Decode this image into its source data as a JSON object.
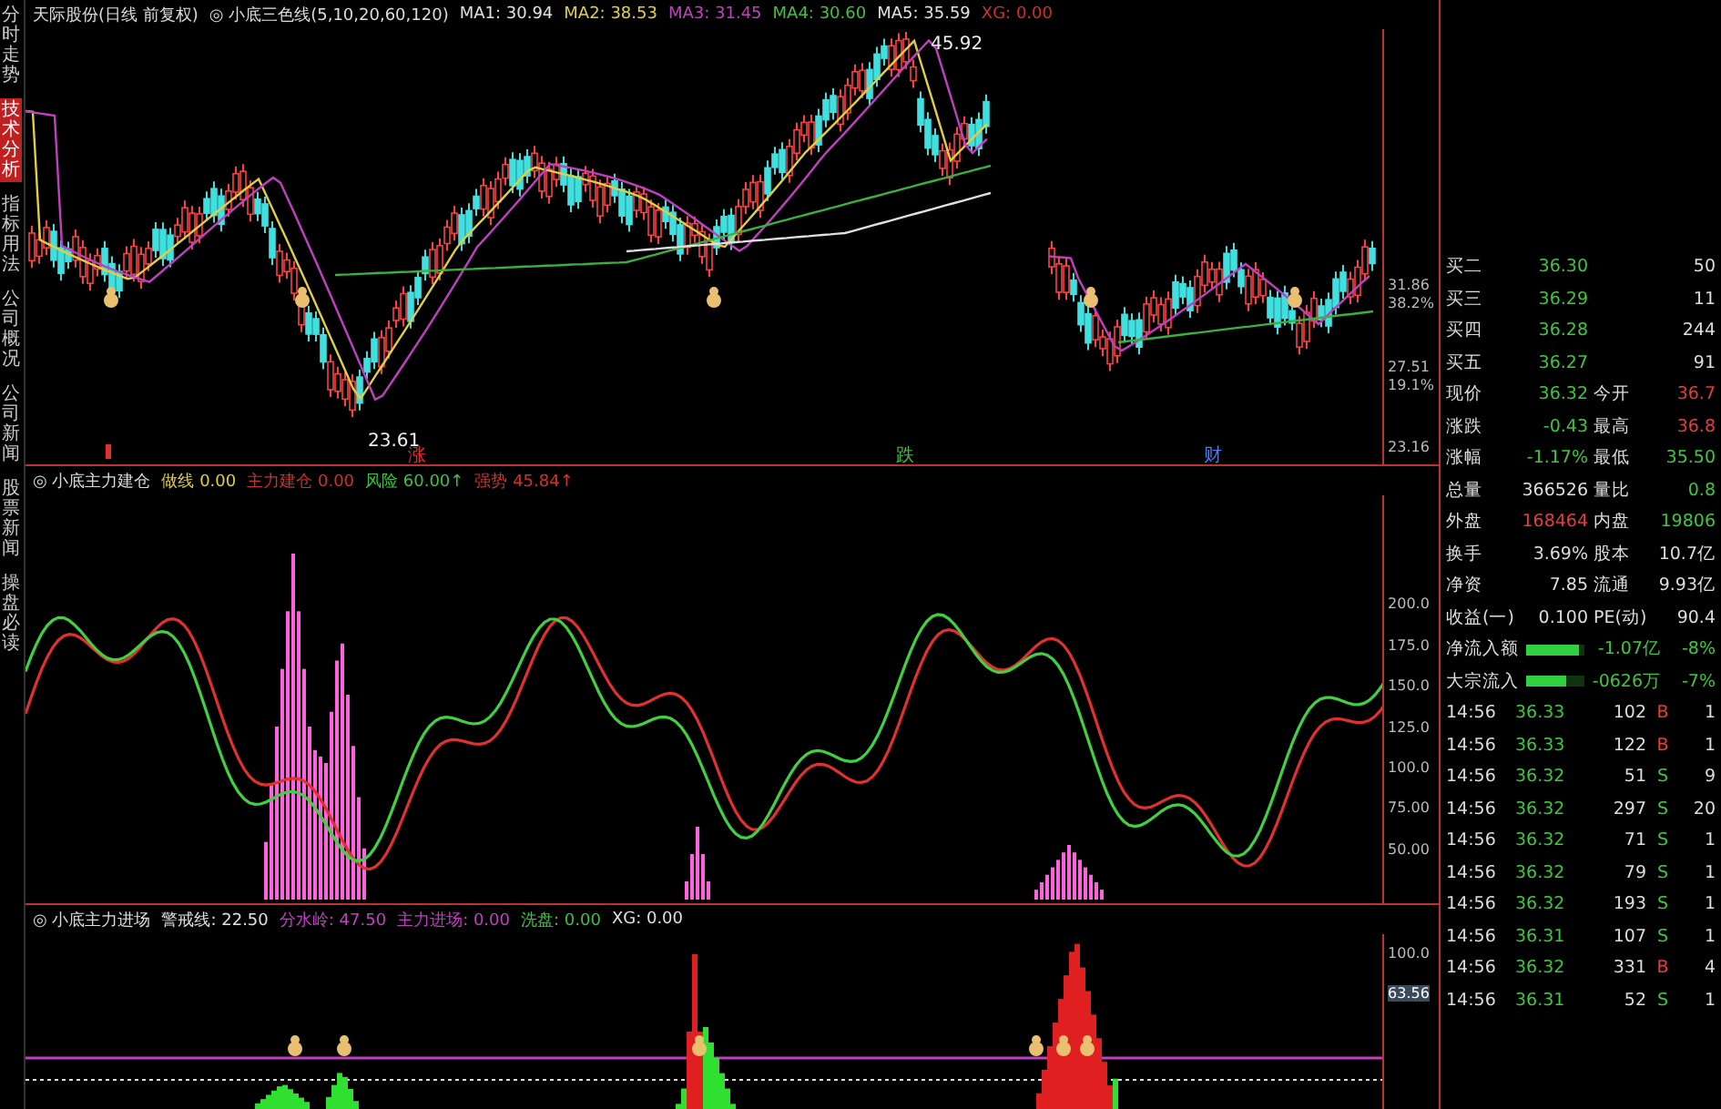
{
  "side_tabs": [
    {
      "label": "分时走势",
      "selected": false
    },
    {
      "label": "技术分析",
      "selected": true
    },
    {
      "label": "指标用法",
      "selected": false
    },
    {
      "label": "公司概况",
      "selected": false
    },
    {
      "label": "公司新闻",
      "selected": false
    },
    {
      "label": "股票新闻",
      "selected": false
    },
    {
      "label": "操盘必读",
      "selected": false
    }
  ],
  "price_panel": {
    "stock": "天际股份(日线 前复权)",
    "indicator": "◎ 小底三色线(5,10,20,60,120)",
    "values": [
      {
        "label": "MA1:",
        "value": "30.94",
        "color": "#e0e0e0"
      },
      {
        "label": "MA2:",
        "value": "38.53",
        "color": "#e0d040"
      },
      {
        "label": "MA3:",
        "value": "31.45",
        "color": "#c040c0"
      },
      {
        "label": "MA4:",
        "value": "30.60",
        "color": "#40c040"
      },
      {
        "label": "MA5:",
        "value": "35.59",
        "color": "#e0e0e0"
      },
      {
        "label": "XG:",
        "value": "0.00",
        "color": "#d03030"
      }
    ],
    "high_label": "45.92",
    "low_label": "23.61",
    "events": [
      {
        "label": "涨",
        "color": "#e03030"
      },
      {
        "label": "跌",
        "color": "#40c040"
      },
      {
        "label": "财",
        "color": "#4080ff"
      }
    ],
    "axis": [
      "31.86",
      "38.2%",
      "27.51",
      "19.1%",
      "23.16"
    ]
  },
  "build_panel": {
    "indicator": "◎ 小底主力建仓",
    "values": [
      {
        "label": "做线",
        "value": "0.00",
        "color": "#e0d040"
      },
      {
        "label": "主力建仓",
        "value": "0.00",
        "color": "#d03030"
      },
      {
        "label": "风险",
        "value": "60.00↑",
        "color": "#40c040"
      },
      {
        "label": "强势",
        "value": "45.84↑",
        "color": "#d03030"
      }
    ],
    "axis": [
      "200.0",
      "175.0",
      "150.0",
      "125.0",
      "100.0",
      "75.00",
      "50.00"
    ]
  },
  "entry_panel": {
    "indicator": "◎ 小底主力进场",
    "values": [
      {
        "label": "警戒线:",
        "value": "22.50",
        "color": "#e0e0e0"
      },
      {
        "label": "分水岭:",
        "value": "47.50",
        "color": "#c040c0"
      },
      {
        "label": "主力进场:",
        "value": "0.00",
        "color": "#c040c0"
      },
      {
        "label": "洗盘:",
        "value": "0.00",
        "color": "#40c040"
      },
      {
        "label": "XG:",
        "value": "0.00",
        "color": "#e0e0e0"
      }
    ],
    "axis": [
      "100.0",
      "63.56"
    ]
  },
  "quote_rows": [
    {
      "label": "买二",
      "value": {
        "text": "36.30",
        "color": "#3cc83c"
      },
      "value_2": {
        "text": "50",
        "color": "#dddddd"
      }
    },
    {
      "label": "买三",
      "value": {
        "text": "36.29",
        "color": "#3cc83c"
      },
      "value_2": {
        "text": "11",
        "color": "#dddddd"
      }
    },
    {
      "label": "买四",
      "value": {
        "text": "36.28",
        "color": "#3cc83c"
      },
      "value_2": {
        "text": "244",
        "color": "#dddddd"
      }
    },
    {
      "label": "买五",
      "value": {
        "text": "36.27",
        "color": "#3cc83c"
      },
      "value_2": {
        "text": "91",
        "color": "#dddddd"
      }
    },
    {
      "label": "现价",
      "value": {
        "text": "36.32",
        "color": "#3cc83c"
      },
      "label_2": "今开",
      "value_2": {
        "text": "36.7",
        "color": "#e83c3c"
      }
    },
    {
      "label": "涨跌",
      "value": {
        "text": "-0.43",
        "color": "#3cc83c"
      },
      "label_2": "最高",
      "value_2": {
        "text": "36.8",
        "color": "#e83c3c"
      }
    },
    {
      "label": "涨幅",
      "value": {
        "text": "-1.17%",
        "color": "#3cc83c"
      },
      "label_2": "最低",
      "value_2": {
        "text": "35.50",
        "color": "#3cc83c"
      }
    },
    {
      "label": "总量",
      "value": {
        "text": "366526",
        "color": "#dddddd"
      },
      "label_2": "量比",
      "value_2": {
        "text": "0.8",
        "color": "#3cc83c"
      }
    },
    {
      "label": "外盘",
      "value": {
        "text": "168464",
        "color": "#e83c3c"
      },
      "label_2": "内盘",
      "value_2": {
        "text": "19806",
        "color": "#3cc83c"
      }
    },
    {
      "label": "换手",
      "value": {
        "text": "3.69%",
        "color": "#dddddd"
      },
      "label_2": "股本",
      "value_2": {
        "text": "10.7亿",
        "color": "#dddddd"
      }
    },
    {
      "label": "净资",
      "value": {
        "text": "7.85",
        "color": "#dddddd"
      },
      "label_2": "流通",
      "value_2": {
        "text": "9.93亿",
        "color": "#dddddd"
      }
    },
    {
      "label": "收益(一)",
      "value": {
        "text": "0.100",
        "color": "#dddddd"
      },
      "label_2": "PE(动)",
      "value_2": {
        "text": "90.4",
        "color": "#dddddd"
      }
    }
  ],
  "flow_rows": [
    {
      "label": "净流入额",
      "level": 0.9,
      "value": "-1.07亿",
      "percent": "-8%"
    },
    {
      "label": "大宗流入",
      "level": 0.7,
      "value": "-0626万",
      "percent": "-7%"
    }
  ],
  "ticks": [
    {
      "time": "14:56",
      "price": "36.33",
      "volume": "102",
      "side": "B",
      "kind": "buy",
      "column_5": "1"
    },
    {
      "time": "14:56",
      "price": "36.33",
      "volume": "122",
      "side": "B",
      "kind": "buy",
      "column_5": "1"
    },
    {
      "time": "14:56",
      "price": "36.32",
      "volume": "51",
      "side": "S",
      "kind": "sell",
      "column_5": "9"
    },
    {
      "time": "14:56",
      "price": "36.32",
      "volume": "297",
      "side": "S",
      "kind": "sell",
      "column_5": "20"
    },
    {
      "time": "14:56",
      "price": "36.32",
      "volume": "71",
      "side": "S",
      "kind": "sell",
      "column_5": "1"
    },
    {
      "time": "14:56",
      "price": "36.32",
      "volume": "79",
      "side": "S",
      "kind": "sell",
      "column_5": "1"
    },
    {
      "time": "14:56",
      "price": "36.32",
      "volume": "193",
      "side": "S",
      "kind": "sell",
      "column_5": "1"
    },
    {
      "time": "14:56",
      "price": "36.31",
      "volume": "107",
      "side": "S",
      "kind": "sell",
      "column_5": "1"
    },
    {
      "time": "14:56",
      "price": "36.32",
      "volume": "331",
      "side": "B",
      "kind": "buy",
      "column_5": "4"
    },
    {
      "time": "14:56",
      "price": "36.31",
      "volume": "52",
      "side": "S",
      "kind": "sell",
      "column_5": "1"
    }
  ]
}
